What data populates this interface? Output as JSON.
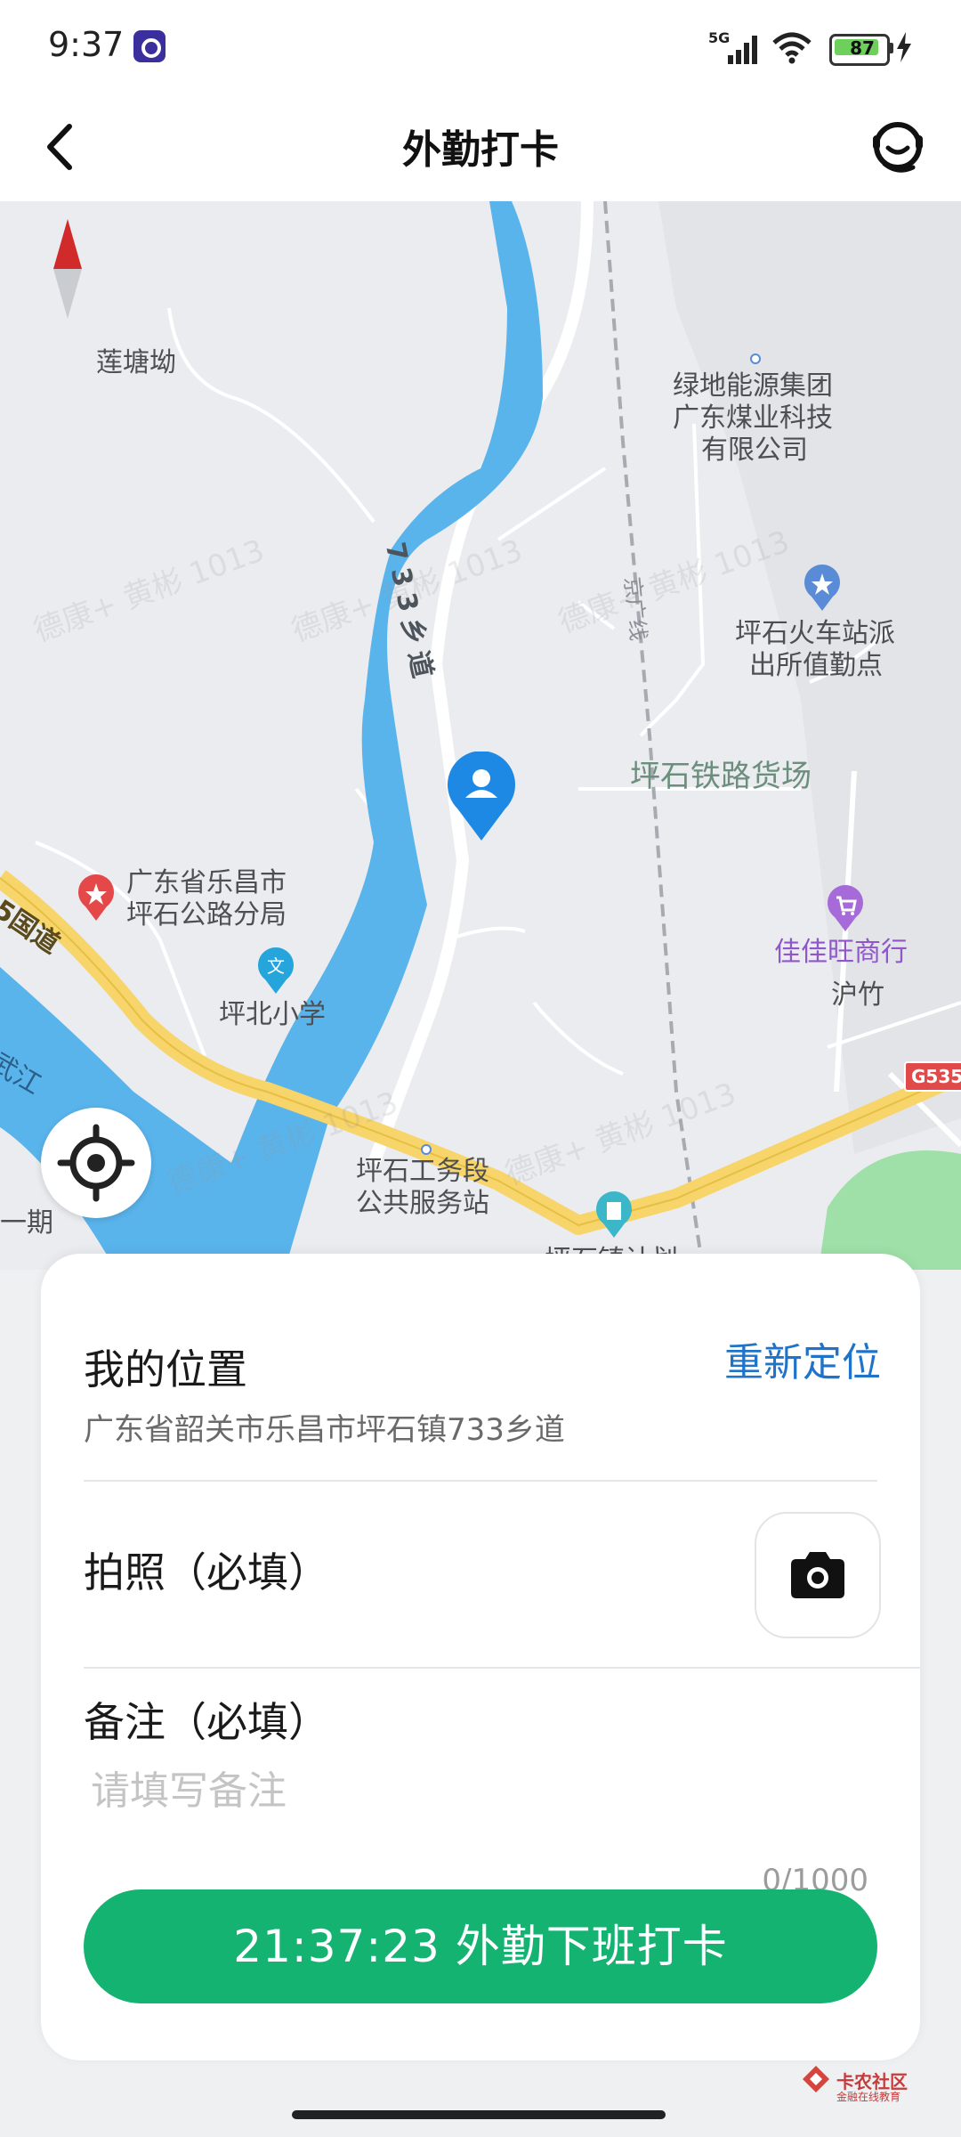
{
  "status_bar": {
    "time": "9:37",
    "network": "5G",
    "battery": "87",
    "battery_level_percent": 87
  },
  "header": {
    "title": "外勤打卡",
    "back_icon": "chevron-left-icon",
    "support_icon": "customer-service-icon"
  },
  "map": {
    "labels": {
      "lianTang": "莲塘坳",
      "lvdi1": "绿地能源集团",
      "lvdi2": "广东煤业科技",
      "lvdi3": "有限公司",
      "road733": "733乡道",
      "jingguang": "京广线",
      "police1": "坪石火车站派",
      "police2": "出所值勤点",
      "freightYard": "坪石铁路货场",
      "highway1": "广东省乐昌市",
      "highway2": "坪石公路分局",
      "guodao": "5国道",
      "school": "坪北小学",
      "jiajia": "佳佳旺商行",
      "huzhu": "沪竹",
      "g535": "G535",
      "wujiang": "武江",
      "yiqi": "一期",
      "service1": "坪石工务段",
      "service2": "公共服务站",
      "cutoff": "坪石镇计划"
    },
    "watermark": "德康+ 黄彬 1013",
    "locate_icon": "locate-crosshair-icon",
    "marker_icon": "user-location-pin-icon"
  },
  "card": {
    "location_title": "我的位置",
    "relocate": "重新定位",
    "address": "广东省韶关市乐昌市坪石镇733乡道",
    "photo_label": "拍照（必填）",
    "camera_icon": "camera-icon",
    "remark_label": "备注（必填）",
    "remark_placeholder": "请填写备注",
    "remark_value": "",
    "remark_counter": "0/1000",
    "clock_out_button": "21:37:23 外勤下班打卡"
  },
  "footer": {
    "logo_name": "卡农社区",
    "logo_sub": "金融在线教育"
  },
  "colors": {
    "accent_green": "#14b372",
    "link_blue": "#1f73c9",
    "river": "#5ab4ec",
    "highway": "#f7d56a"
  }
}
